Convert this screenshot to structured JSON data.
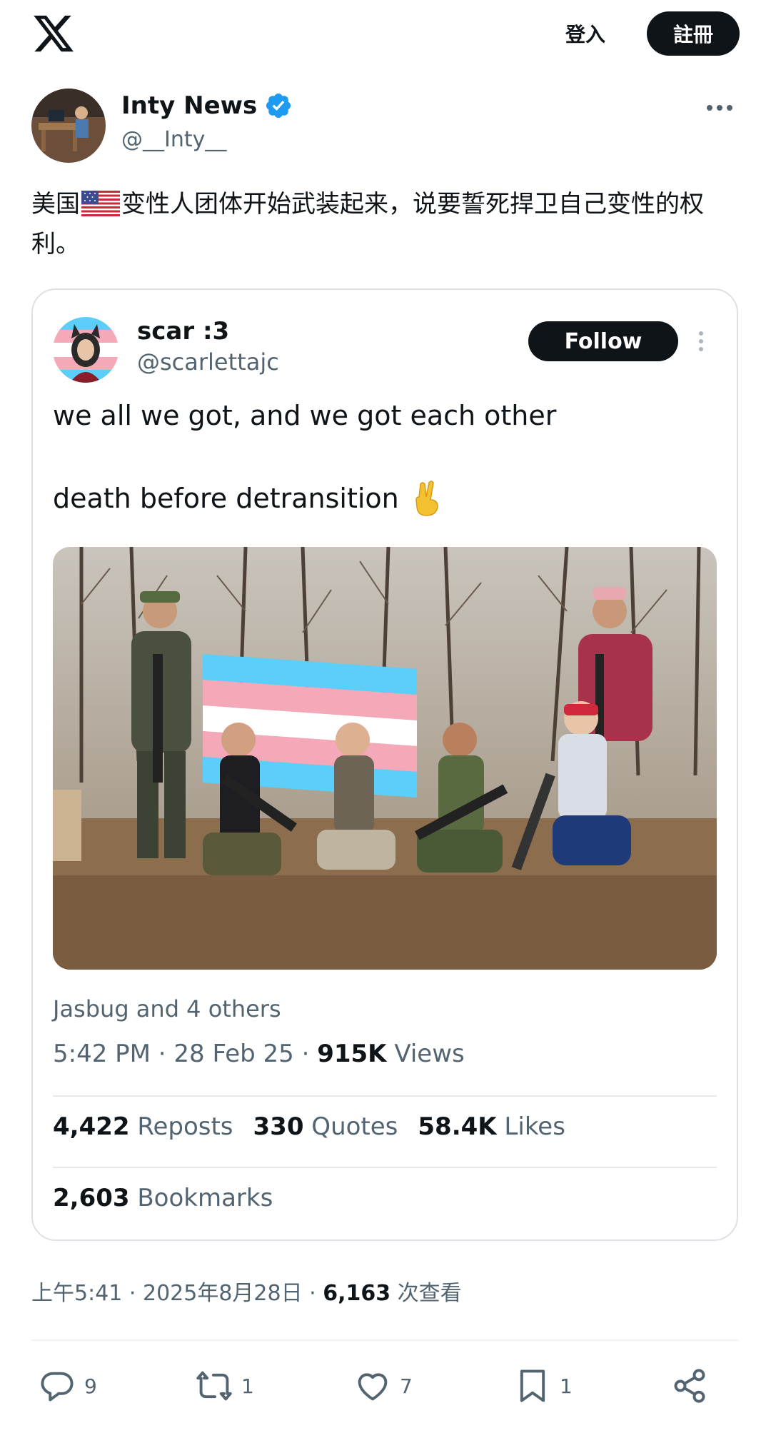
{
  "header": {
    "login_label": "登入",
    "signup_label": "註冊"
  },
  "post": {
    "display_name": "Inty News",
    "handle": "@__Inty__",
    "text_before_flag": "美国",
    "text_after_flag": "变性人团体开始武装起来，说要誓死捍卫自己变性的权利。",
    "timestamp": "上午5:41 · 2025年8月28日 · ",
    "views_count": "6,163",
    "views_label": " 次查看"
  },
  "quoted": {
    "display_name": "scar :3",
    "handle": "@scarlettajc",
    "follow_label": "Follow",
    "line1": "we all we got, and we got each other",
    "line2": "death before detransition",
    "likers": "Jasbug and 4 others",
    "meta_time": "5:42 PM · 28 Feb 25 · ",
    "views_count": "915K",
    "views_label": " Views",
    "reposts_count": "4,422",
    "reposts_label": " Reposts",
    "quotes_count": "330",
    "quotes_label": " Quotes",
    "likes_count": "58.4K",
    "likes_label": " Likes",
    "bookmarks_count": "2,603",
    "bookmarks_label": " Bookmarks"
  },
  "actions": {
    "replies": "9",
    "reposts": "1",
    "likes": "7",
    "bookmarks": "1"
  },
  "colors": {
    "text": "#0f1419",
    "secondary": "#536471",
    "verified": "#1d9bf0",
    "border": "#dde1e5"
  },
  "icons": [
    "x-logo-icon",
    "verified-badge-icon",
    "more-icon",
    "us-flag-icon",
    "peace-hand-icon",
    "reply-icon",
    "repost-icon",
    "like-icon",
    "bookmark-icon",
    "share-icon"
  ]
}
